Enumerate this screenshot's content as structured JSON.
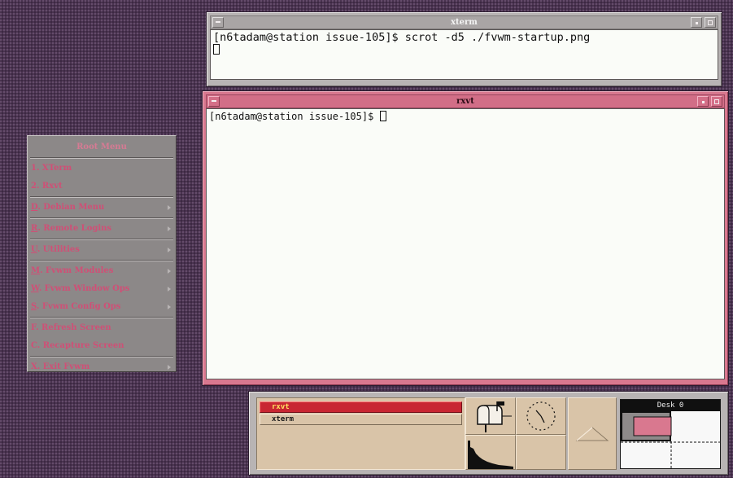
{
  "xterm": {
    "title": "xterm",
    "line1": "[n6tadam@station issue-105]$ scrot -d5 ./fvwm-startup.png"
  },
  "rxvt": {
    "title": "rxvt",
    "line1": "[n6tadam@station issue-105]$ "
  },
  "root_menu": {
    "title": "Root Menu",
    "items": [
      {
        "accel": "1",
        "label": ". XTerm",
        "has_submenu": false
      },
      {
        "accel": "2",
        "label": ". Rxvt",
        "has_submenu": false
      },
      {
        "accel": "D",
        "label": ". Debian Menu",
        "has_submenu": true
      },
      {
        "accel": "R",
        "label": ". Remote Logins",
        "has_submenu": true
      },
      {
        "accel": "U",
        "label": ". Utilities",
        "has_submenu": true
      },
      {
        "accel": "M",
        "label": ". Fvwm Modules",
        "has_submenu": true
      },
      {
        "accel": "W",
        "label": ". Fvwm Window Ops",
        "has_submenu": true
      },
      {
        "accel": "S",
        "label": ". Fvwm Config Ops",
        "has_submenu": true
      },
      {
        "accel": "F",
        "label": ". Refresh Screen",
        "has_submenu": false
      },
      {
        "accel": "C",
        "label": ". Recapture Screen",
        "has_submenu": false
      },
      {
        "accel": "X",
        "label": ". Exit Fvwm",
        "has_submenu": true
      }
    ]
  },
  "taskbar": {
    "tasks": [
      {
        "label": "rxvt",
        "active": true
      },
      {
        "label": "xterm",
        "active": false
      }
    ]
  },
  "pager": {
    "desk_label": "Desk 0"
  },
  "colors": {
    "desktop": "#4a3450",
    "frame_focused": "#d9788f",
    "frame_unfocused": "#b8b4b4",
    "menu_text": "#d04f76",
    "panel_tan": "#d9c4a8",
    "task_active": "#c82632"
  }
}
